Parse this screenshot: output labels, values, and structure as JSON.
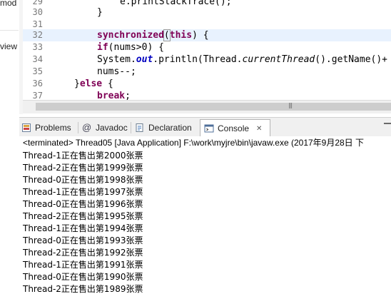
{
  "left_panel": {
    "fragment_top": "mod",
    "fragment_mid": "view"
  },
  "editor": {
    "lines": [
      {
        "no": "29",
        "text": "e.printStackTrace();"
      },
      {
        "no": "30",
        "text": "}"
      },
      {
        "no": "31",
        "text": ""
      },
      {
        "no": "32",
        "kw": "synchronized",
        "open": "(",
        "arg": "this",
        "rest": ") {"
      },
      {
        "no": "33",
        "kw": "if",
        "rest": "(nums>0) {"
      },
      {
        "no": "34",
        "pre": "System.",
        "field": "out",
        "mid": ".println(Thread.",
        "method": "currentThread",
        "post": "().getName()+"
      },
      {
        "no": "35",
        "text": "nums--;"
      },
      {
        "no": "36",
        "pre": "}",
        "kw": "else",
        "rest": " {"
      },
      {
        "no": "37",
        "kw": "break",
        "rest": ";"
      }
    ],
    "scroll_grip": "|||"
  },
  "tabs": [
    {
      "label": "Problems",
      "icon": "problems-icon"
    },
    {
      "label": "Javadoc",
      "icon": "at-icon"
    },
    {
      "label": "Declaration",
      "icon": "declaration-icon"
    },
    {
      "label": "Console",
      "icon": "console-icon",
      "close": "✕"
    }
  ],
  "console": {
    "header": "<terminated> Thread05 [Java Application] F:\\work\\myjre\\bin\\javaw.exe (2017年9月28日 下",
    "output": [
      "Thread-1正在售出第2000张票",
      "Thread-2正在售出第1999张票",
      "Thread-0正在售出第1998张票",
      "Thread-1正在售出第1997张票",
      "Thread-0正在售出第1996张票",
      "Thread-2正在售出第1995张票",
      "Thread-1正在售出第1994张票",
      "Thread-0正在售出第1993张票",
      "Thread-2正在售出第1992张票",
      "Thread-1正在售出第1991张票",
      "Thread-0正在售出第1990张票",
      "Thread-2正在售出第1989张票"
    ]
  },
  "colors": {
    "keyword": "#7f0055",
    "field": "#0000c0",
    "line_number": "#787878",
    "current_line": "#e8f2fe"
  }
}
